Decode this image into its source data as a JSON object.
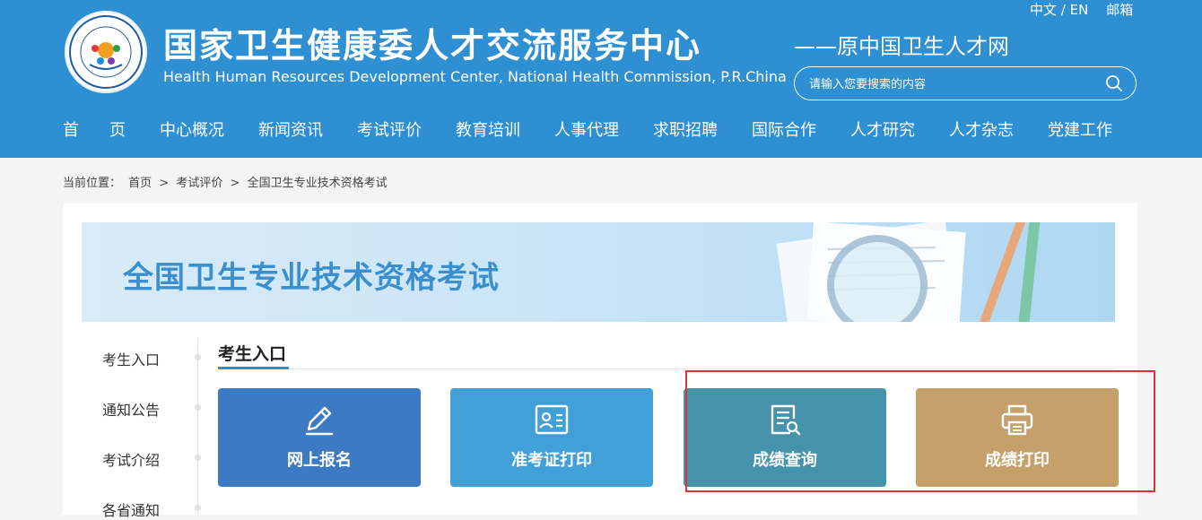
{
  "header": {
    "title_cn": "国家卫生健康委人才交流服务中心",
    "title_en": "Health Human Resources Development Center, National Health Commission, P.R.China",
    "subtitle": "——原中国卫生人才网",
    "lang_switch": "中文 / EN",
    "mail_link": "邮箱",
    "logo_text": "国家卫生健康委人才交流服务中心",
    "search": {
      "placeholder": "请输入您要搜索的内容",
      "icon": "search-icon"
    },
    "bg_color": "#2e8fd3"
  },
  "nav": {
    "items": [
      "首页",
      "中心概况",
      "新闻资讯",
      "考试评价",
      "教育培训",
      "人事代理",
      "求职招聘",
      "国际合作",
      "人才研究",
      "人才杂志",
      "党建工作"
    ]
  },
  "breadcrumb": {
    "prefix": "当前位置：",
    "items": [
      "首页",
      "考试评价",
      "全国卫生专业技术资格考试"
    ],
    "separator": ">"
  },
  "banner": {
    "title": "全国卫生专业技术资格考试"
  },
  "sidebar": {
    "items": [
      "考生入口",
      "通知公告",
      "考试介绍",
      "各省通知"
    ]
  },
  "section": {
    "title": "考生入口",
    "accent": "#2e8fd3",
    "cards": [
      {
        "label": "网上报名",
        "icon": "pen-edit-icon",
        "color": "#3c7ac3"
      },
      {
        "label": "准考证打印",
        "icon": "id-card-icon",
        "color": "#42a0d9"
      },
      {
        "label": "成绩查询",
        "icon": "document-search-icon",
        "color": "#4593ab"
      },
      {
        "label": "成绩打印",
        "icon": "printer-icon",
        "color": "#c6a06b"
      }
    ]
  },
  "highlight_color": "#d93535"
}
